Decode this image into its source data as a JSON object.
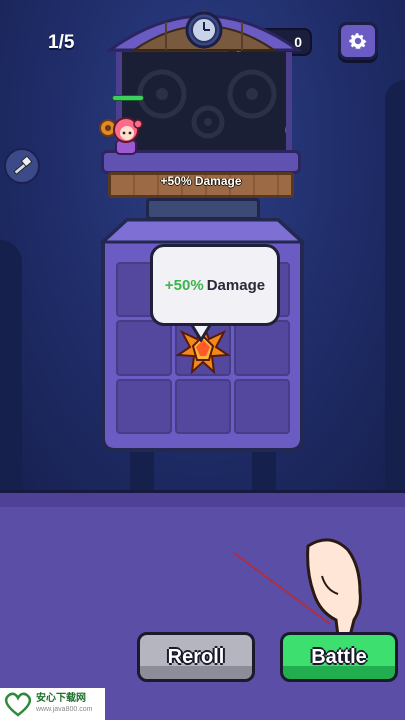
{
  "hud": {
    "level": "1/5",
    "currency_value": "0",
    "gem_icon": "green-gem-icon",
    "settings_icon": "gear-icon"
  },
  "tower": {
    "bonus_label": "+50% Damage"
  },
  "tooltip": {
    "percent": "+50%",
    "stat": "Damage"
  },
  "buttons": {
    "reroll": "Reroll",
    "battle": "Battle"
  },
  "watermark": {
    "title": "安心下载网",
    "url": "www.java800.com"
  },
  "colors": {
    "battle": "#3de06e",
    "reroll": "#b5b5c0",
    "bonus_green": "#39b54a",
    "panel": "#5b4ea6"
  }
}
